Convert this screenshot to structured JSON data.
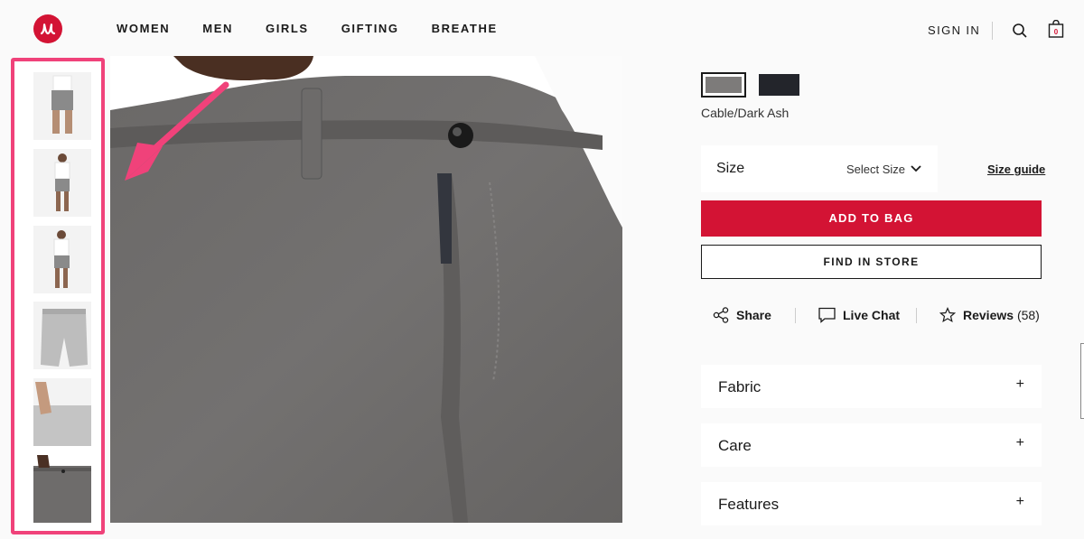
{
  "header": {
    "nav": [
      "WOMEN",
      "MEN",
      "GIRLS",
      "GIFTING",
      "BREATHE"
    ],
    "signin_label": "SIGN IN",
    "bag_count": "0",
    "brand_color": "#d31334"
  },
  "gallery": {
    "highlight_color": "#f0427a",
    "thumbnails": [
      "thumb-front-full",
      "thumb-model-full",
      "thumb-model-side",
      "thumb-shorts-flat",
      "thumb-pocket-detail",
      "thumb-waist-detail"
    ]
  },
  "product": {
    "swatches": [
      {
        "name": "Cable/Dark Ash",
        "color": "#7d7b7a",
        "selected": true
      },
      {
        "name": "",
        "color": "#23252b",
        "selected": false
      }
    ],
    "color_name": "Cable/Dark Ash",
    "size_label": "Size",
    "size_select": "Select Size",
    "size_guide_label": "Size guide",
    "add_to_bag_label": "ADD TO BAG",
    "find_in_store_label": "FIND IN STORE",
    "actions": {
      "share": "Share",
      "live_chat": "Live Chat",
      "reviews": "Reviews",
      "reviews_count": "(58)"
    },
    "accordions": [
      "Fabric",
      "Care",
      "Features"
    ],
    "accordion_icon": "+"
  }
}
